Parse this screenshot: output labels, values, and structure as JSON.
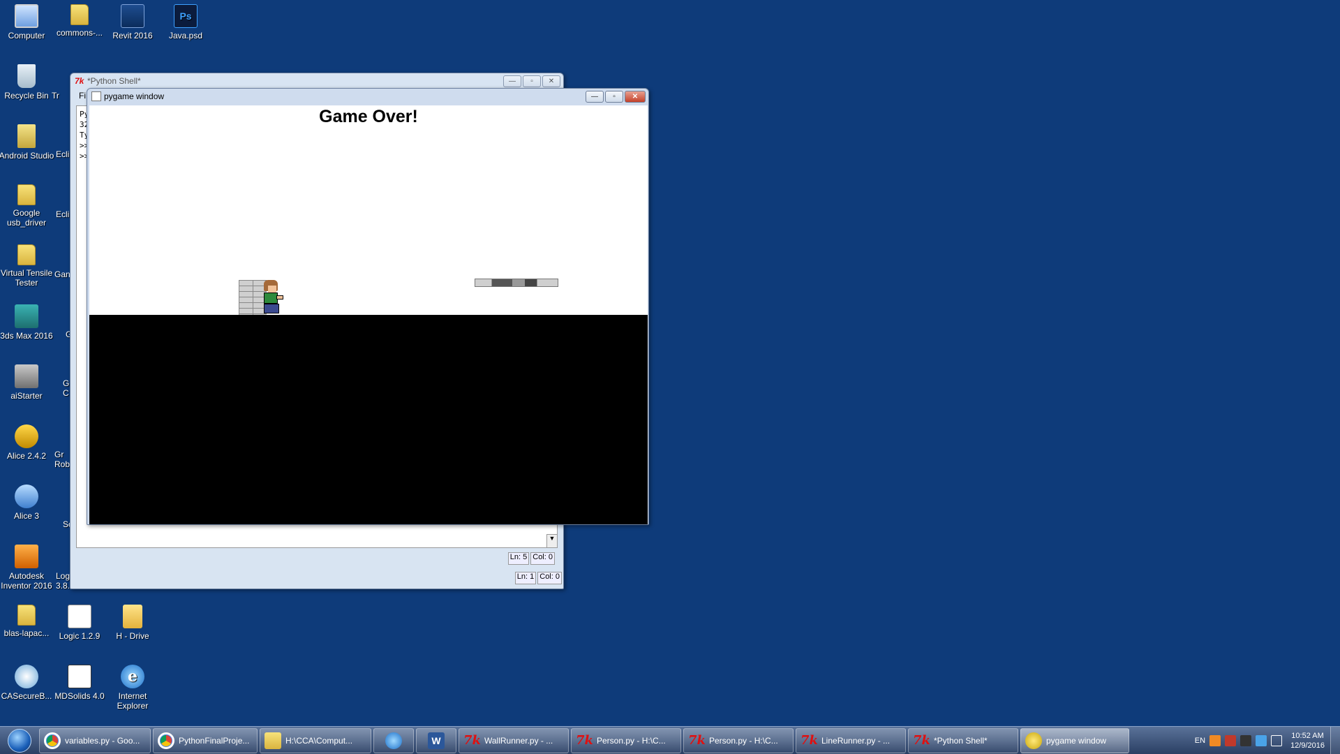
{
  "desktop": {
    "icons": [
      {
        "label": "Computer",
        "icon": "computer-icon"
      },
      {
        "label": "commons-...",
        "icon": "folder-icon"
      },
      {
        "label": "Revit 2016",
        "icon": "revit-icon"
      },
      {
        "label": "Java.psd",
        "icon": "photoshop-file-icon",
        "glyph": "Ps"
      },
      {
        "label": "Recycle Bin",
        "icon": "recycle-bin-icon"
      },
      {
        "label": "Android Studio",
        "icon": "android-studio-icon"
      },
      {
        "label": "Google usb_driver",
        "icon": "folder-icon"
      },
      {
        "label": "Virtual Tensile Tester",
        "icon": "folder-icon"
      },
      {
        "label": "3ds Max 2016",
        "icon": "3ds-max-icon"
      },
      {
        "label": "aiStarter",
        "icon": "aistarter-icon"
      },
      {
        "label": "Alice 2.4.2",
        "icon": "alice-icon"
      },
      {
        "label": "Alice 3",
        "icon": "alice3-icon"
      },
      {
        "label": "Autodesk Inventor 2016",
        "icon": "inventor-icon"
      },
      {
        "label": "blas-lapac...",
        "icon": "folder-icon"
      },
      {
        "label": "Logic 1.2.9",
        "icon": "logic-icon"
      },
      {
        "label": "H - Drive",
        "icon": "network-drive-icon"
      },
      {
        "label": "CASecureB...",
        "icon": "casecure-icon"
      },
      {
        "label": "MDSolids 4.0",
        "icon": "mdsolids-icon"
      },
      {
        "label": "Internet Explorer",
        "icon": "internet-explorer-icon",
        "glyph": "e"
      }
    ],
    "partial_labels": [
      "Tr",
      "Ecli",
      "Ecli",
      "Gan",
      "G",
      "G C",
      "Gr Rob",
      "Sc",
      "Logger 3.8.7"
    ]
  },
  "python_shell": {
    "title": "*Python Shell*",
    "menu_partial": "Fi",
    "console_lines": [
      "Py",
      "32",
      "Ty",
      ">>",
      ">>"
    ],
    "status_inner": {
      "ln": "Ln: 5",
      "col": "Col: 0"
    },
    "status_outer": {
      "ln": "Ln: 1",
      "col": "Col: 0"
    }
  },
  "pygame": {
    "title": "pygame window",
    "game_over_text": "Game Over!",
    "sky_color": "#ffffff",
    "ground_color": "#000000"
  },
  "window_buttons": {
    "minimize": "—",
    "maximize": "▫",
    "close": "✕"
  },
  "taskbar": {
    "items": [
      {
        "label": "variables.py - Goo...",
        "icon": "chrome-icon"
      },
      {
        "label": "PythonFinalProje...",
        "icon": "chrome-icon"
      },
      {
        "label": "H:\\CCA\\Comput...",
        "icon": "folder-icon"
      },
      {
        "label": "",
        "icon": "internet-explorer-icon"
      },
      {
        "label": "",
        "icon": "word-icon",
        "glyph": "W"
      },
      {
        "label": "WallRunner.py - ...",
        "icon": "idle-icon"
      },
      {
        "label": "Person.py - H:\\C...",
        "icon": "idle-icon"
      },
      {
        "label": "Person.py - H:\\C...",
        "icon": "idle-icon"
      },
      {
        "label": "LineRunner.py - ...",
        "icon": "idle-icon"
      },
      {
        "label": "*Python Shell*",
        "icon": "idle-icon"
      },
      {
        "label": "pygame window",
        "icon": "pygame-icon"
      }
    ],
    "language": "EN",
    "time": "10:52 AM",
    "date": "12/9/2016"
  }
}
